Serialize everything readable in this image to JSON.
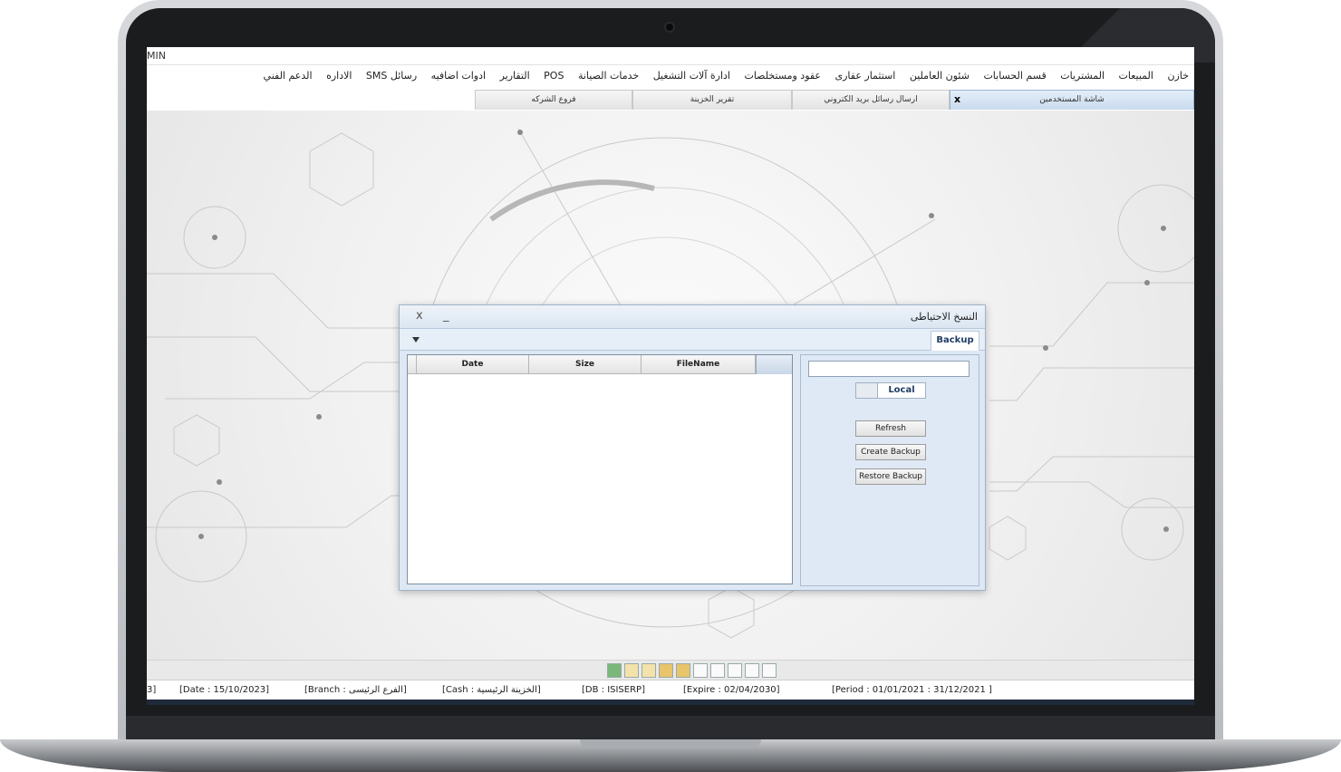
{
  "window": {
    "title": "MIN"
  },
  "menu": [
    "خازن",
    "المبيعات",
    "المشتريات",
    "قسم الحسابات",
    "شئون العاملين",
    "استثمار عقارى",
    "عقود ومستخلصات",
    "ادارة آلات التشغيل",
    "خدمات الصيانة",
    "POS",
    "التقارير",
    "ادوات اضافيه",
    "رسائل SMS",
    "الاداره",
    "الدعم الفني"
  ],
  "tabs": [
    "شاشة المستخدمين",
    "ارسال رسائل بريد الكتروني",
    "تقرير الخزينة",
    "فروع الشركه"
  ],
  "tab_close": "x",
  "dialog": {
    "title": "النسخ الاحتياطى",
    "close": "x",
    "minimize": "_",
    "tab": "Backup",
    "columns": [
      "Date",
      "Size",
      "FileName"
    ],
    "storage_option": "Local",
    "buttons": {
      "refresh": "Refresh",
      "create": "Create Backup",
      "restore": "Restore Backup"
    }
  },
  "status": {
    "left_fragment": "3]",
    "date": "[Date : 15/10/2023]",
    "branch": "[Branch : الفرع الرئيسى]",
    "cash": "[Cash : الخزينة الرئيسية]",
    "db": "[DB : ISISERP]",
    "expire": "[Expire : 02/04/2030]",
    "period": "[Period : 01/01/2021 : 31/12/2021 ]"
  }
}
